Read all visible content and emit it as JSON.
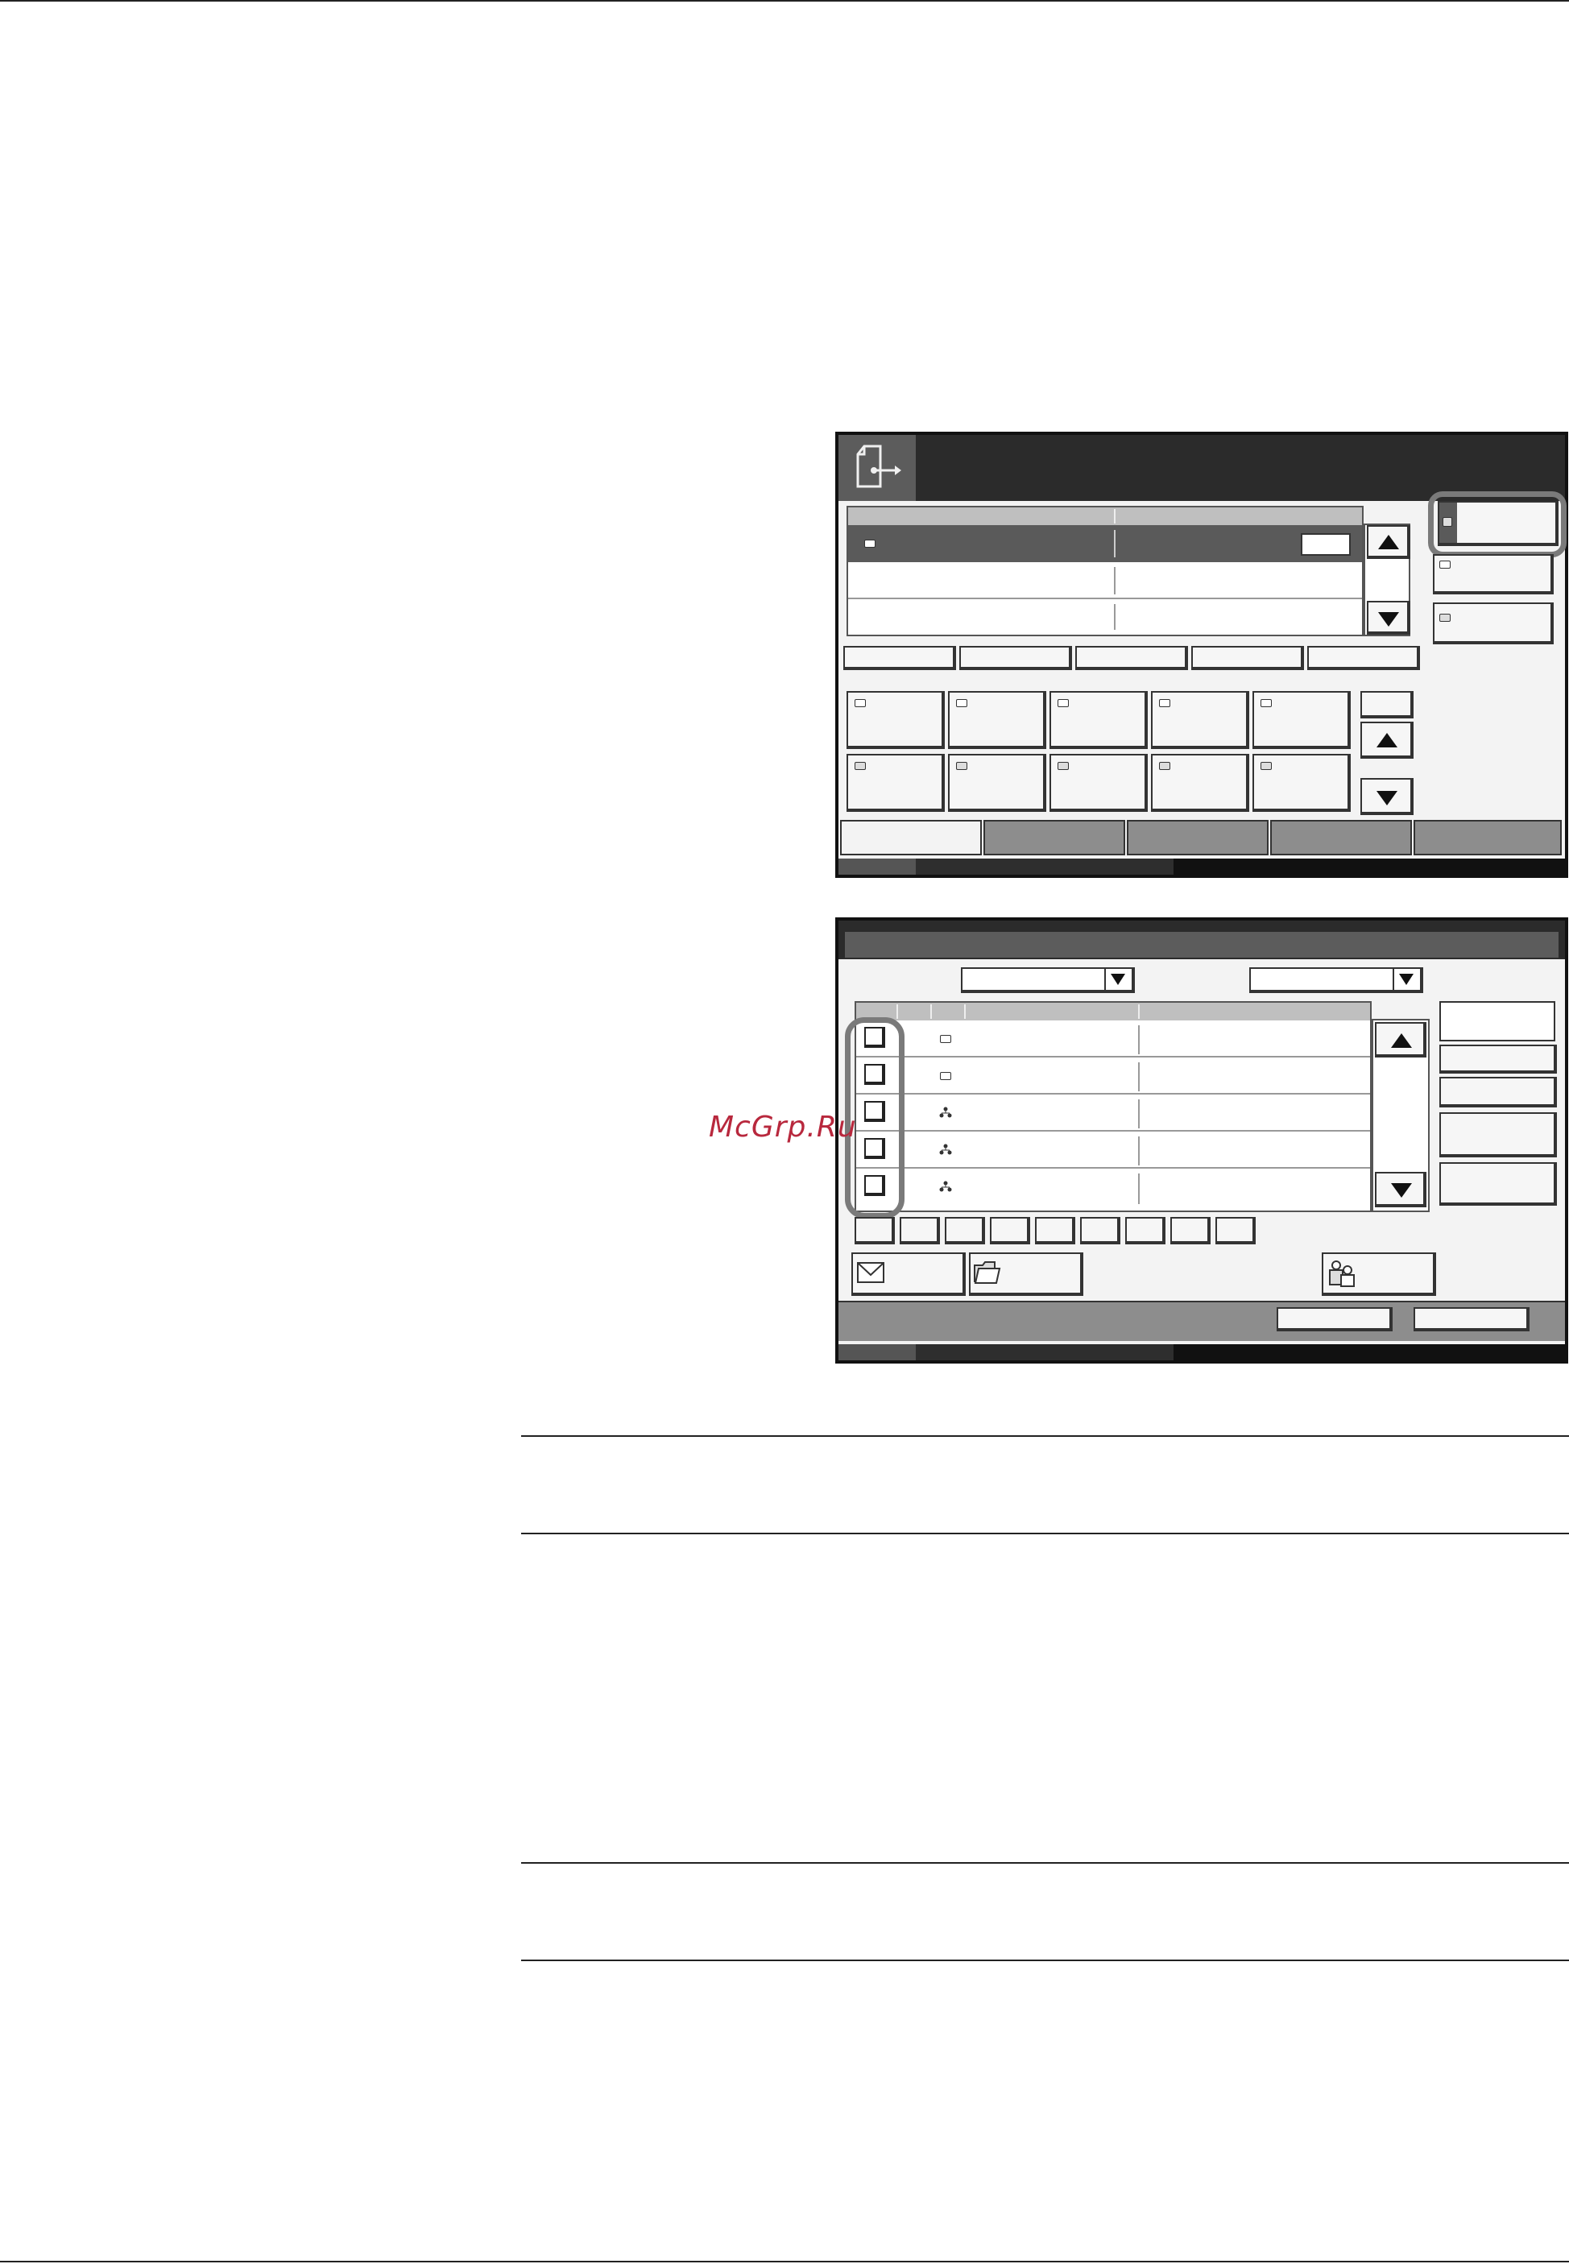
{
  "watermark": {
    "text": "McGrp.Ru"
  },
  "panel1": {
    "tabs_bottom_count": 5,
    "favorite_rows": 3,
    "filter_buttons": 5,
    "address_grid": {
      "rows": 2,
      "cols": 5
    }
  },
  "panel2": {
    "list_rows": 5,
    "quick_keys": 9,
    "row_icons": [
      "email-icon",
      "email-icon",
      "group-icon",
      "group-icon",
      "group-icon"
    ]
  },
  "colors": {
    "header_dark": "#2b2b2b",
    "selected_row": "#5a5a5a",
    "tab_gray": "#8d8d8d",
    "highlight_ring": "#7a7a7a",
    "watermark_red": "#b8283d"
  }
}
